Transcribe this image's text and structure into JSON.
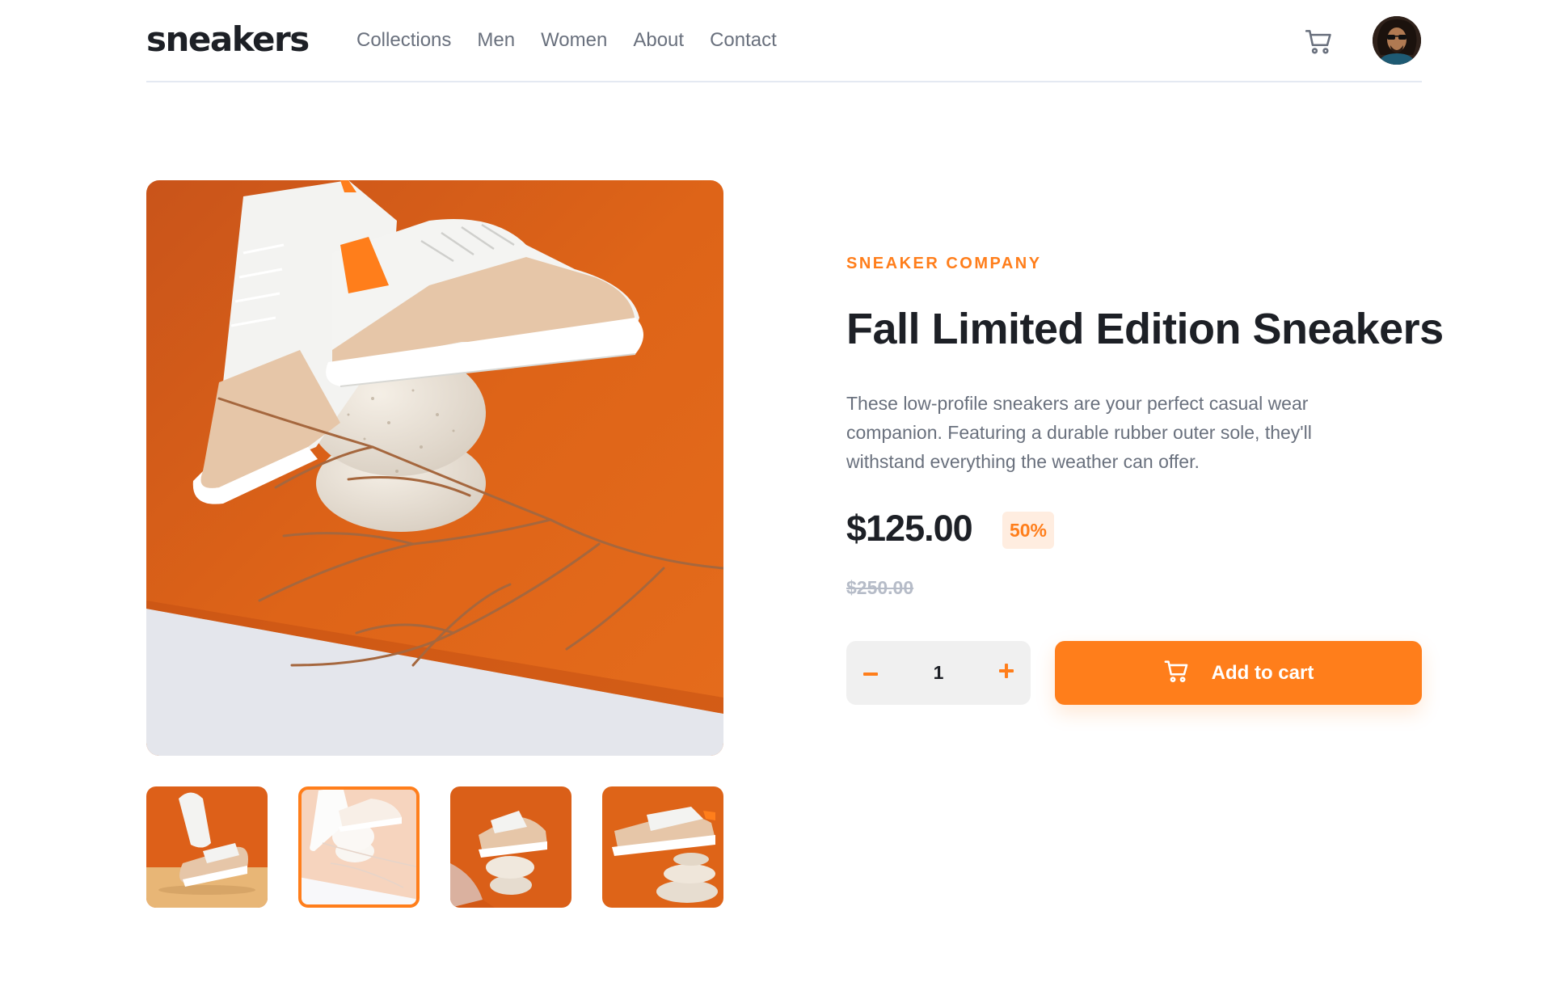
{
  "header": {
    "logo": "sneakers",
    "nav": [
      "Collections",
      "Men",
      "Women",
      "About",
      "Contact"
    ],
    "icons": {
      "cart": "cart-icon",
      "avatar": "user-avatar"
    }
  },
  "gallery": {
    "main_image": "sneakers-on-stones-orange-background",
    "thumbnails": [
      {
        "image": "sneaker-upright-thumbnail",
        "active": false
      },
      {
        "image": "sneakers-on-stones-thumbnail",
        "active": true
      },
      {
        "image": "sneaker-on-stones-curled-paper-thumbnail",
        "active": false
      },
      {
        "image": "sneaker-balanced-on-stones-thumbnail",
        "active": false
      }
    ]
  },
  "product": {
    "company": "SNEAKER COMPANY",
    "title": "Fall Limited Edition Sneakers",
    "description": "These low-profile sneakers are your perfect casual wear companion. Featuring a durable rubber outer sole, they'll withstand everything the weather can offer.",
    "price": "$125.00",
    "discount": "50%",
    "original_price": "$250.00",
    "quantity": "1",
    "add_to_cart_label": "Add to cart"
  },
  "colors": {
    "accent": "#ff7e1b",
    "accent_pale": "#ffede0",
    "text_dark": "#1d2026",
    "text_gray": "#69707d",
    "text_light": "#b6bcc8"
  }
}
